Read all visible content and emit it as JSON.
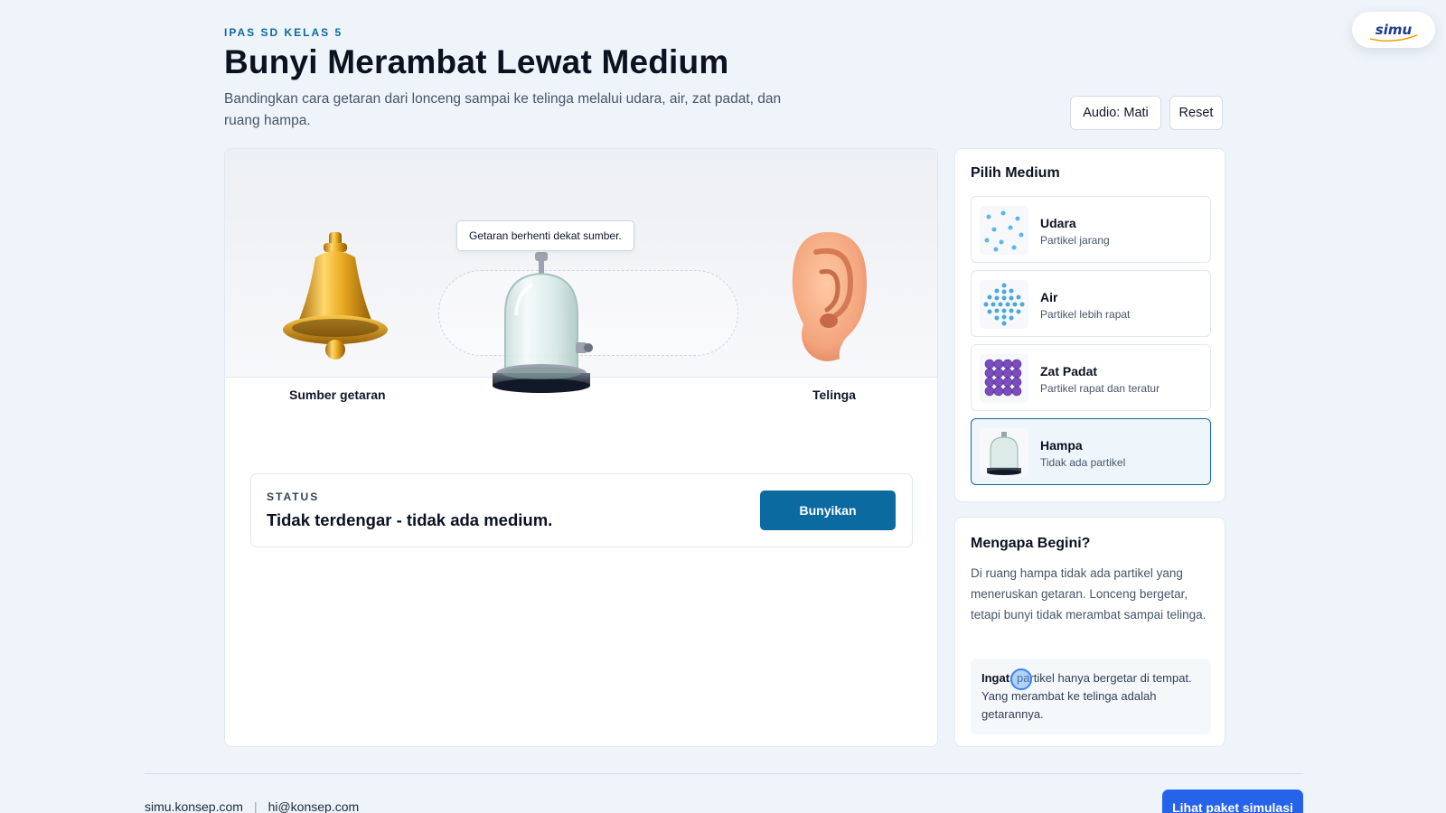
{
  "brand": {
    "logo_text": "simu"
  },
  "header": {
    "kicker": "IPAS SD KELAS 5",
    "title": "Bunyi Merambat Lewat Medium",
    "subtitle": "Bandingkan cara getaran dari lonceng sampai ke telinga melalui udara, air, zat padat, dan ruang hampa.",
    "audio_label": "Audio: Mati",
    "reset_label": "Reset"
  },
  "scene": {
    "tooltip": "Getaran berhenti dekat sumber.",
    "source_label": "Sumber getaran",
    "ear_label": "Telinga",
    "source_icon": "bell-icon",
    "medium_icon": "bell-jar-icon",
    "receiver_icon": "ear-icon"
  },
  "status": {
    "kicker": "STATUS",
    "text": "Tidak terdengar - tidak ada medium.",
    "button_label": "Bunyikan"
  },
  "medium_panel": {
    "title": "Pilih Medium",
    "selected": "Hampa",
    "items": [
      {
        "name": "Udara",
        "desc": "Partikel jarang",
        "icon": "sparse-particles-icon"
      },
      {
        "name": "Air",
        "desc": "Partikel lebih rapat",
        "icon": "dense-particles-icon"
      },
      {
        "name": "Zat Padat",
        "desc": "Partikel rapat dan teratur",
        "icon": "solid-lattice-icon"
      },
      {
        "name": "Hampa",
        "desc": "Tidak ada partikel",
        "icon": "bell-jar-icon"
      }
    ]
  },
  "why_panel": {
    "title": "Mengapa Begini?",
    "body": "Di ruang hampa tidak ada partikel yang meneruskan getaran. Lonceng bergetar, tetapi bunyi tidak merambat sampai telinga.",
    "remember_label": "Ingat:",
    "remember_text": "partikel hanya bergetar di tempat. Yang merambat ke telinga adalah getarannya."
  },
  "footer": {
    "site": "simu.konsep.com",
    "separator": "|",
    "email": "hi@konsep.com",
    "cta_label": "Lihat paket simulasi"
  },
  "colors": {
    "accent": "#0b6aa0",
    "cta": "#2563eb",
    "background": "#eef4fa"
  }
}
